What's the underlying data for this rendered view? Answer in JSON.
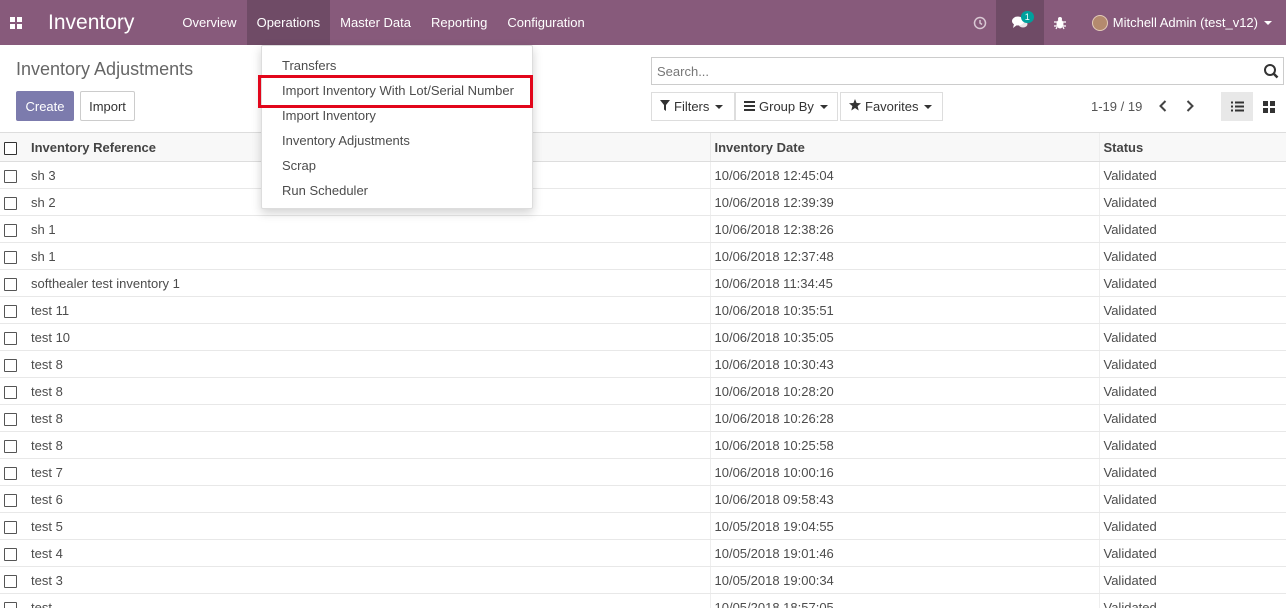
{
  "navbar": {
    "brand": "Inventory",
    "menu": [
      {
        "label": "Overview"
      },
      {
        "label": "Operations"
      },
      {
        "label": "Master Data"
      },
      {
        "label": "Reporting"
      },
      {
        "label": "Configuration"
      }
    ],
    "chat_badge": "1",
    "user": "Mitchell Admin (test_v12)"
  },
  "dropdown": {
    "items": [
      {
        "label": "Transfers"
      },
      {
        "label": "Import Inventory With Lot/Serial Number"
      },
      {
        "label": "Import Inventory"
      },
      {
        "label": "Inventory Adjustments"
      },
      {
        "label": "Scrap"
      },
      {
        "label": "Run Scheduler"
      }
    ],
    "highlight_color": "#e2061b"
  },
  "control": {
    "title": "Inventory Adjustments",
    "create_label": "Create",
    "import_label": "Import",
    "search_placeholder": "Search...",
    "filters_label": "Filters",
    "groupby_label": "Group By",
    "favorites_label": "Favorites",
    "pager": "1-19 / 19"
  },
  "table": {
    "headers": {
      "ref": "Inventory Reference",
      "date": "Inventory Date",
      "status": "Status"
    },
    "rows": [
      {
        "ref": "sh 3",
        "date": "10/06/2018 12:45:04",
        "status": "Validated"
      },
      {
        "ref": "sh 2",
        "date": "10/06/2018 12:39:39",
        "status": "Validated"
      },
      {
        "ref": "sh 1",
        "date": "10/06/2018 12:38:26",
        "status": "Validated"
      },
      {
        "ref": "sh 1",
        "date": "10/06/2018 12:37:48",
        "status": "Validated"
      },
      {
        "ref": "softhealer test inventory 1",
        "date": "10/06/2018 11:34:45",
        "status": "Validated"
      },
      {
        "ref": "test 11",
        "date": "10/06/2018 10:35:51",
        "status": "Validated"
      },
      {
        "ref": "test 10",
        "date": "10/06/2018 10:35:05",
        "status": "Validated"
      },
      {
        "ref": "test 8",
        "date": "10/06/2018 10:30:43",
        "status": "Validated"
      },
      {
        "ref": "test 8",
        "date": "10/06/2018 10:28:20",
        "status": "Validated"
      },
      {
        "ref": "test 8",
        "date": "10/06/2018 10:26:28",
        "status": "Validated"
      },
      {
        "ref": "test 8",
        "date": "10/06/2018 10:25:58",
        "status": "Validated"
      },
      {
        "ref": "test 7",
        "date": "10/06/2018 10:00:16",
        "status": "Validated"
      },
      {
        "ref": "test 6",
        "date": "10/06/2018 09:58:43",
        "status": "Validated"
      },
      {
        "ref": "test 5",
        "date": "10/05/2018 19:04:55",
        "status": "Validated"
      },
      {
        "ref": "test 4",
        "date": "10/05/2018 19:01:46",
        "status": "Validated"
      },
      {
        "ref": "test 3",
        "date": "10/05/2018 19:00:34",
        "status": "Validated"
      },
      {
        "ref": "test",
        "date": "10/05/2018 18:57:05",
        "status": "Validated"
      }
    ]
  },
  "colors": {
    "navbar": "#875a7b",
    "navbar_active": "#6f4b66",
    "primary": "#7c7bad",
    "badge": "#00a09d"
  }
}
